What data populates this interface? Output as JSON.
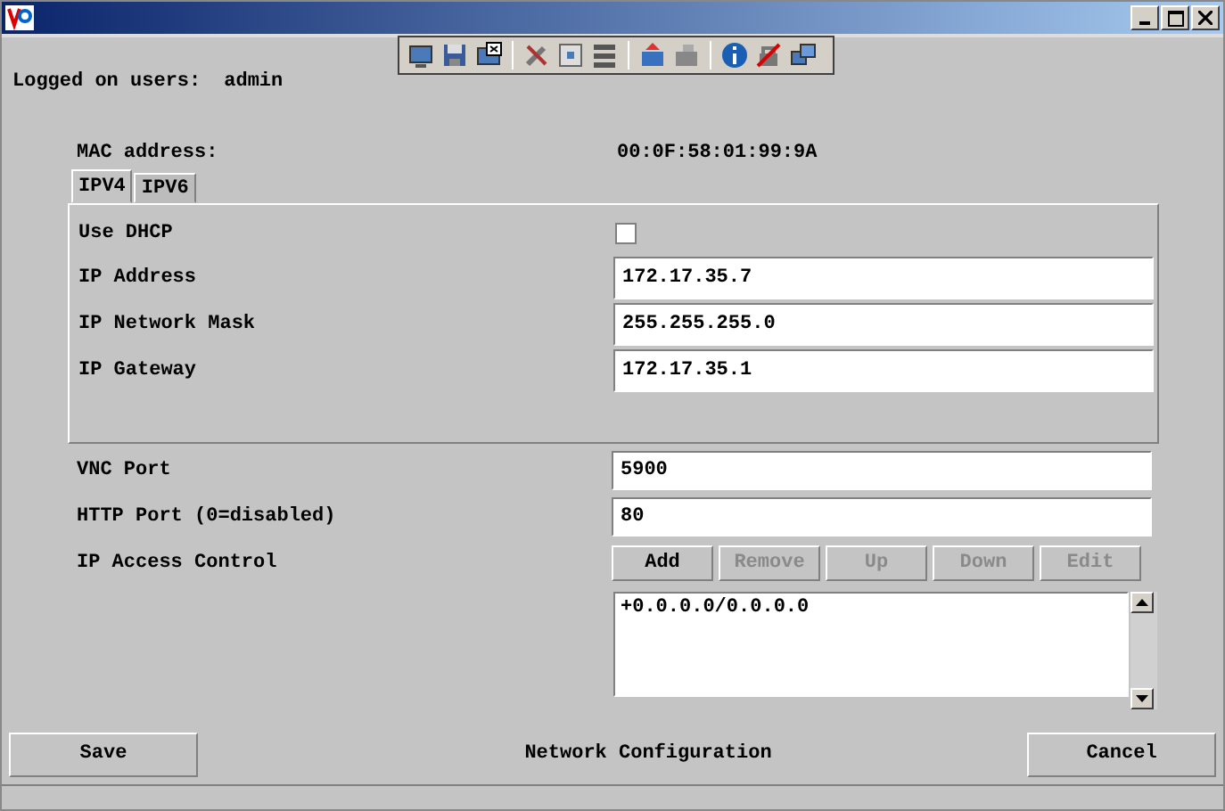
{
  "session": {
    "label": "Logged on users:",
    "user": "admin"
  },
  "mac": {
    "label": "MAC address:",
    "value": "00:0F:58:01:99:9A"
  },
  "tabs": [
    {
      "label": "IPV4",
      "selected": true
    },
    {
      "label": "IPV6",
      "selected": false
    }
  ],
  "ipv4": {
    "dhcp": {
      "label": "Use DHCP",
      "checked": false
    },
    "fields": [
      {
        "label": "IP Address",
        "value": "172.17.35.7"
      },
      {
        "label": "IP Network Mask",
        "value": "255.255.255.0"
      },
      {
        "label": "IP Gateway",
        "value": "172.17.35.1"
      }
    ]
  },
  "ports": [
    {
      "label": "VNC Port",
      "value": "5900"
    },
    {
      "label": "HTTP Port (0=disabled)",
      "value": "80"
    }
  ],
  "access": {
    "label": "IP Access Control",
    "buttons": [
      {
        "label": "Add",
        "disabled": false
      },
      {
        "label": "Remove",
        "disabled": true
      },
      {
        "label": "Up",
        "disabled": true
      },
      {
        "label": "Down",
        "disabled": true
      },
      {
        "label": "Edit",
        "disabled": true
      }
    ],
    "entries": [
      "+0.0.0.0/0.0.0.0"
    ]
  },
  "footer": {
    "save": "Save",
    "title": "Network Configuration",
    "cancel": "Cancel"
  }
}
